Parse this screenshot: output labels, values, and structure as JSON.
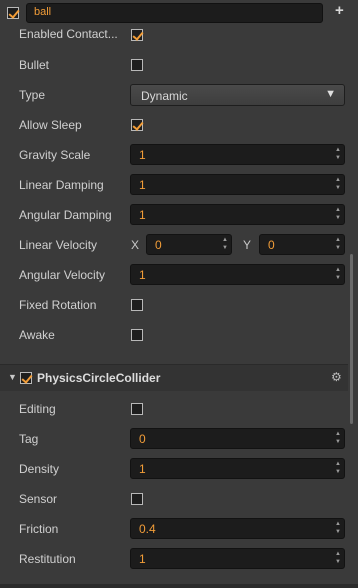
{
  "node": {
    "enabled": true,
    "name": "ball"
  },
  "rigidbody": {
    "enabled_contact_label": "Enabled Contact...",
    "enabled_contact": true,
    "bullet_label": "Bullet",
    "bullet": false,
    "type_label": "Type",
    "type_value": "Dynamic",
    "allow_sleep_label": "Allow Sleep",
    "allow_sleep": true,
    "gravity_scale_label": "Gravity Scale",
    "gravity_scale": "1",
    "linear_damping_label": "Linear Damping",
    "linear_damping": "1",
    "angular_damping_label": "Angular Damping",
    "angular_damping": "1",
    "linear_velocity_label": "Linear Velocity",
    "x_label": "X",
    "linear_velocity_x": "0",
    "y_label": "Y",
    "linear_velocity_y": "0",
    "angular_velocity_label": "Angular Velocity",
    "angular_velocity": "1",
    "fixed_rotation_label": "Fixed Rotation",
    "fixed_rotation": false,
    "awake_label": "Awake",
    "awake": false
  },
  "collider": {
    "title": "PhysicsCircleCollider",
    "enabled": true,
    "editing_label": "Editing",
    "editing": false,
    "tag_label": "Tag",
    "tag": "0",
    "density_label": "Density",
    "density": "1",
    "sensor_label": "Sensor",
    "sensor": false,
    "friction_label": "Friction",
    "friction": "0.4",
    "restitution_label": "Restitution",
    "restitution": "1"
  },
  "icons": {
    "add": "plus-icon",
    "settings": "gear-icon",
    "expand": "triangle-down-icon",
    "dropdown": "dropdown-arrow-icon"
  },
  "colors": {
    "accent": "#f29d38",
    "background": "#3a3a3a",
    "field": "#1c1c1c"
  }
}
